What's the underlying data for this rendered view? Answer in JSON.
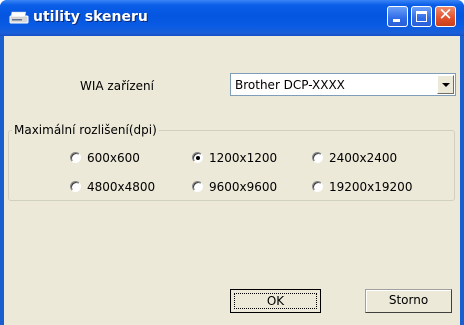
{
  "window": {
    "title": "utility skeneru",
    "icon": "scanner-icon",
    "buttons": [
      "minimize-icon",
      "maximize-icon",
      "close-icon"
    ],
    "close_glyph": "✕"
  },
  "device": {
    "label": "WIA zařízení",
    "selected": "Brother DCP-XXXX"
  },
  "resolution": {
    "legend": "Maximální rozlišení(dpi)",
    "options": [
      {
        "label": "600x600",
        "checked": false
      },
      {
        "label": "1200x1200",
        "checked": true
      },
      {
        "label": "2400x2400",
        "checked": false
      },
      {
        "label": "4800x4800",
        "checked": false
      },
      {
        "label": "9600x9600",
        "checked": false
      },
      {
        "label": "19200x19200",
        "checked": false
      }
    ]
  },
  "actions": {
    "ok_label": "OK",
    "cancel_label": "Storno"
  }
}
